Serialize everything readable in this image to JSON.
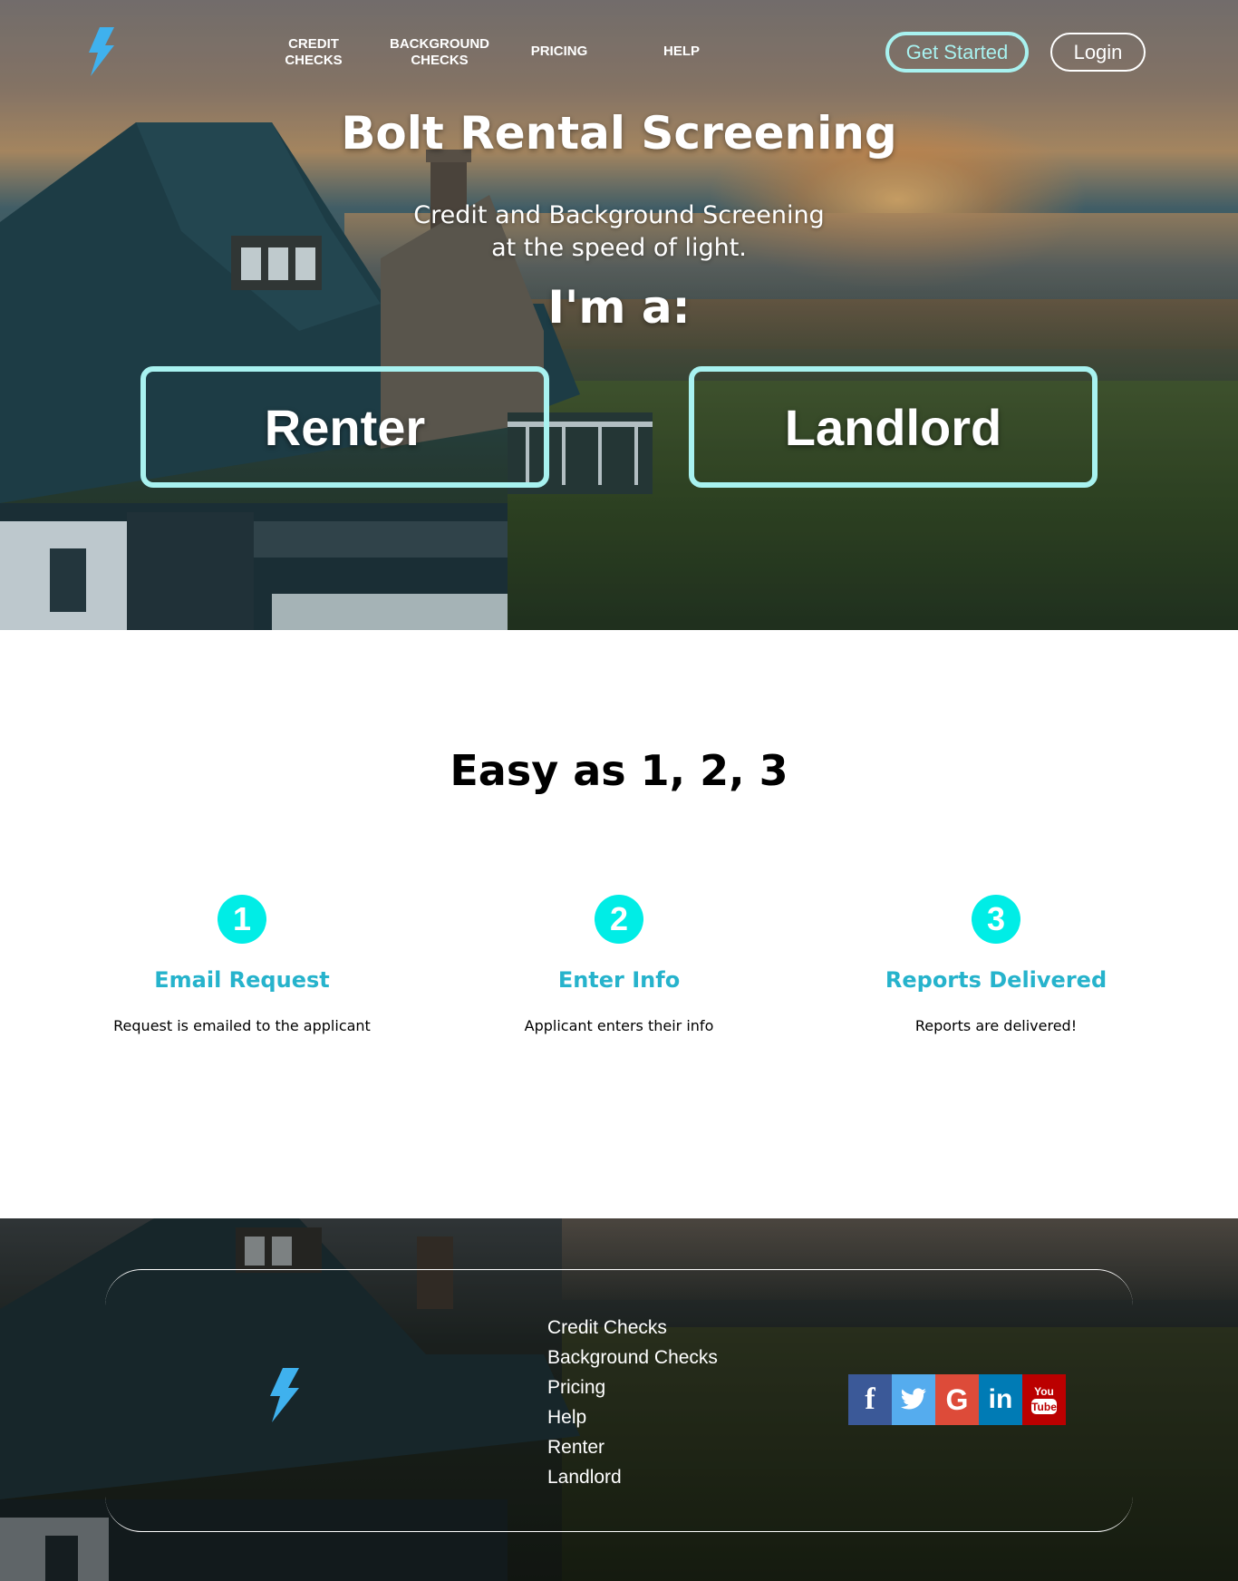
{
  "nav": {
    "links": [
      {
        "label_line1": "CREDIT",
        "label_line2": "CHECKS"
      },
      {
        "label_line1": "BACKGROUND",
        "label_line2": "CHECKS"
      },
      {
        "label_line1": "PRICING",
        "label_line2": ""
      },
      {
        "label_line1": "HELP",
        "label_line2": ""
      }
    ],
    "get_started_label": "Get Started",
    "login_label": "Login",
    "logo_icon": "lightning-bolt-icon"
  },
  "hero": {
    "title": "Bolt Rental Screening",
    "subtitle_line1": "Credit and Background Screening",
    "subtitle_line2": "at the speed of light.",
    "prompt": "I'm a:",
    "renter_label": "Renter",
    "landlord_label": "Landlord"
  },
  "steps": {
    "title": "Easy as 1, 2, 3",
    "items": [
      {
        "number": "1",
        "title": "Email Request",
        "description": "Request is emailed to the applicant"
      },
      {
        "number": "2",
        "title": "Enter Info",
        "description": "Applicant enters their info"
      },
      {
        "number": "3",
        "title": "Reports Delivered",
        "description": "Reports are delivered!"
      }
    ]
  },
  "footer": {
    "links": [
      "Credit Checks",
      "Background Checks",
      "Pricing",
      "Help",
      "Renter",
      "Landlord"
    ],
    "social": [
      {
        "name": "facebook-icon",
        "glyph": "f",
        "color": "#3b5998"
      },
      {
        "name": "twitter-icon",
        "glyph": "t",
        "color": "#55acee"
      },
      {
        "name": "google-icon",
        "glyph": "G",
        "color": "#dd4b39"
      },
      {
        "name": "linkedin-icon",
        "glyph": "in",
        "color": "#007bb5"
      },
      {
        "name": "youtube-icon",
        "glyph": "You Tube",
        "color": "#bb0000"
      }
    ]
  },
  "colors": {
    "accent_cyan": "#00ede6",
    "button_border": "#a8f2f0",
    "step_title": "#26b3cc",
    "bolt_blue": "#3fb1ee"
  }
}
